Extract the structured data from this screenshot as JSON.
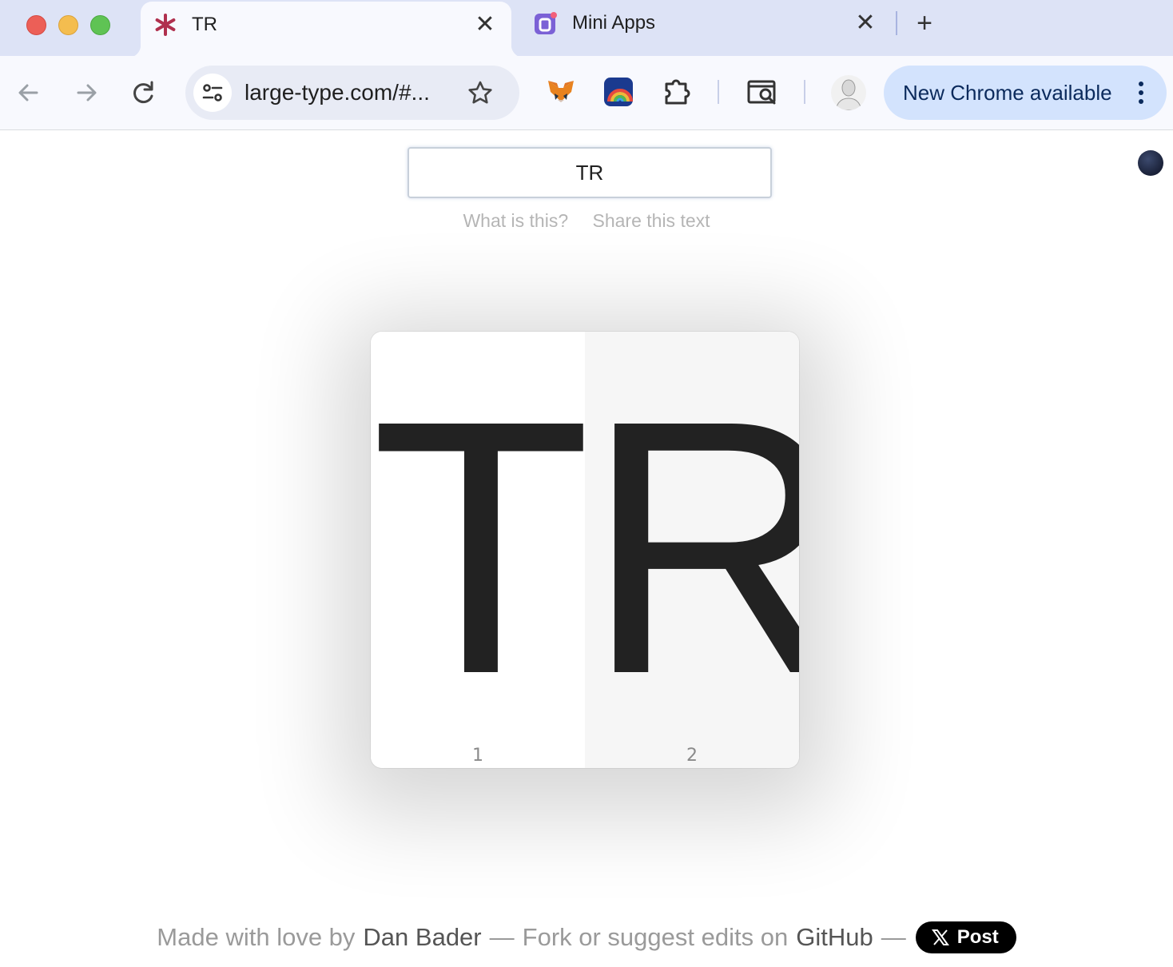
{
  "browser": {
    "tabs": [
      {
        "title": "TR",
        "active": true,
        "favicon": "asterisk-icon"
      },
      {
        "title": "Mini Apps",
        "active": false,
        "favicon": "mini-apps-icon"
      }
    ],
    "new_tab_label": "+",
    "close_glyph": "✕",
    "url": "large-type.com/#...",
    "extensions": [
      "metamask-fox-icon",
      "rainbow-icon",
      "puzzle-extensions-icon",
      "tab-search-icon"
    ],
    "update_label": "New Chrome available"
  },
  "page": {
    "input_value": "TR",
    "links": {
      "what": "What is this?",
      "share": "Share this text"
    },
    "characters": [
      {
        "char": "T",
        "index": "1"
      },
      {
        "char": "R",
        "index": "2"
      }
    ],
    "footer": {
      "made_by": "Made with love by",
      "author": "Dan Bader",
      "sep1": "—",
      "fork": "Fork or suggest edits on",
      "github": "GitHub",
      "sep2": "—",
      "post_label": "Post"
    }
  },
  "colors": {
    "tabstrip": "#dde3f6",
    "toolbar": "#f8f9fe",
    "update_chip": "#d3e3fd",
    "glyph": "#222222"
  }
}
